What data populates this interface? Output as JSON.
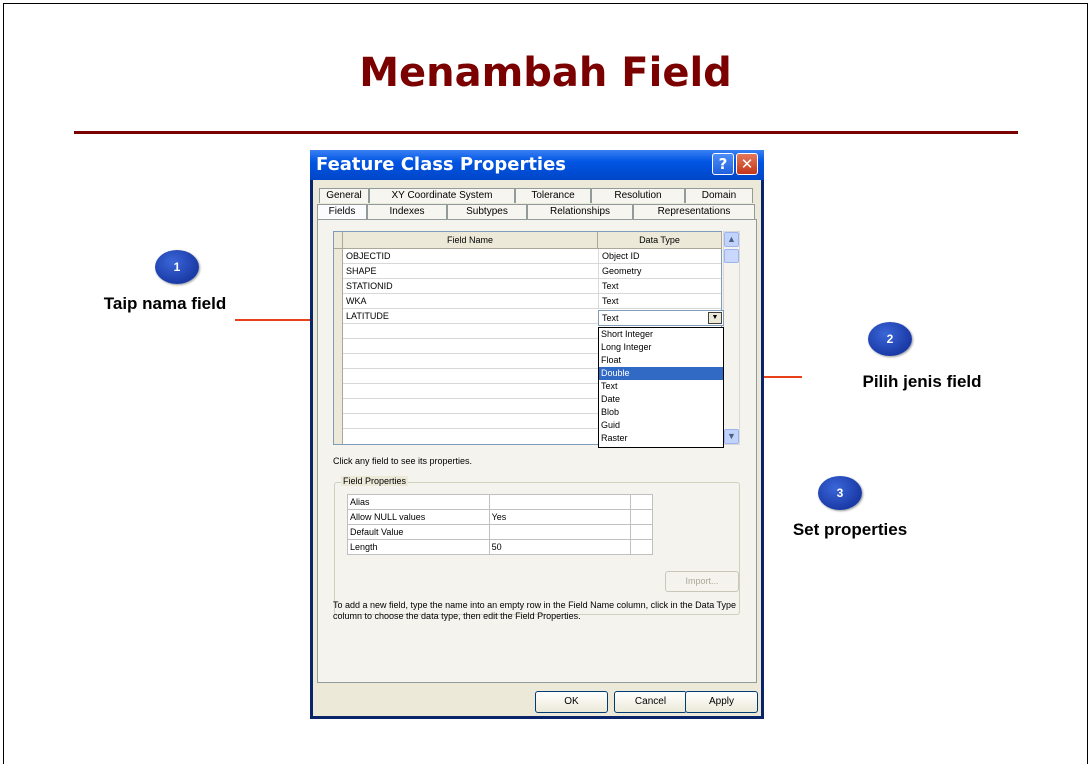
{
  "slide": {
    "title": "Menambah Field",
    "bubbles": [
      "1",
      "2",
      "3"
    ],
    "annotations": [
      "Taip nama field",
      "Pilih jenis field",
      "Set properties"
    ]
  },
  "dialog": {
    "title": "Feature Class Properties",
    "help_glyph": "?",
    "close_glyph": "✕",
    "tabs_back": [
      "General",
      "XY Coordinate System",
      "Tolerance",
      "Resolution",
      "Domain"
    ],
    "tabs_front": [
      "Fields",
      "Indexes",
      "Subtypes",
      "Relationships",
      "Representations"
    ],
    "active_tab": "Fields",
    "grid": {
      "headers": [
        "Field Name",
        "Data Type"
      ],
      "rows": [
        {
          "name": "OBJECTID",
          "type": "Object ID"
        },
        {
          "name": "SHAPE",
          "type": "Geometry"
        },
        {
          "name": "STATIONID",
          "type": "Text"
        },
        {
          "name": "WKA",
          "type": "Text"
        },
        {
          "name": "LATITUDE",
          "type": "Text"
        }
      ]
    },
    "dropdown": {
      "selected": "Double",
      "options": [
        "Short Integer",
        "Long Integer",
        "Float",
        "Double",
        "Text",
        "Date",
        "Blob",
        "Guid",
        "Raster"
      ]
    },
    "hint": "Click any field to see its properties.",
    "field_properties": {
      "legend": "Field Properties",
      "rows": [
        {
          "label": "Alias",
          "value": ""
        },
        {
          "label": "Allow NULL values",
          "value": "Yes"
        },
        {
          "label": "Default Value",
          "value": ""
        },
        {
          "label": "Length",
          "value": "50"
        }
      ]
    },
    "import_label": "Import...",
    "info": "To add a new field, type the name into an empty row in the Field Name column, click in the Data Type column to choose the data type, then edit the Field Properties.",
    "buttons": {
      "ok": "OK",
      "cancel": "Cancel",
      "apply": "Apply"
    }
  },
  "colors": {
    "title": "#7b0000",
    "arrow": "#e8401a",
    "bubble": "#1a3aa6",
    "selection": "#316ac5"
  }
}
